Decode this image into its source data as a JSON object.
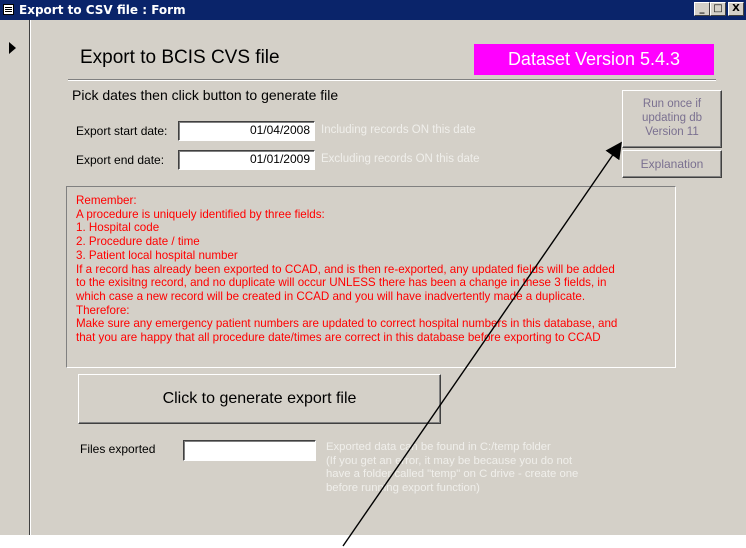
{
  "window": {
    "title": "Export to CSV file : Form",
    "minimize_label": "_",
    "maximize_label": "□",
    "close_label": "X"
  },
  "form": {
    "title": "Export to BCIS CVS file",
    "version_badge": "Dataset Version 5.4.3",
    "instruction": "Pick dates then click button to generate file",
    "start_date": {
      "label": "Export start date:",
      "value": "01/04/2008",
      "hint": "Including records ON this date"
    },
    "end_date": {
      "label": "Export end date:",
      "value": "01/01/2009",
      "hint": "Excluding records ON this date"
    },
    "run_once_button": {
      "line1": "Run once if",
      "line2": "updating db",
      "line3": "Version 11"
    },
    "explanation_button": "Explanation",
    "notes": [
      "Remember:",
      "A procedure is uniquely identified by three fields:",
      "1. Hospital code",
      "2. Procedure date / time",
      "3. Patient local hospital number",
      "If a record has already been exported to CCAD, and is then re-exported, any updated fields will be added",
      "to the exisitng record, and no duplicate will occur UNLESS there has been a change in these 3 fields, in",
      "which case a new record will be created in CCAD and you will have inadvertently made a duplicate.",
      "Therefore:",
      "Make sure any emergency patient numbers are updated to correct hospital numbers in this database, and",
      "that you are happy that all procedure date/times are correct in this database before exporting to CCAD"
    ],
    "generate_button": "Click to generate export file",
    "files_exported": {
      "label": "Files exported",
      "value": "",
      "hint_lines": [
        "Exported data can be found in C:/temp folder",
        "(If you get an error, it may be because you do not",
        "have a folder called \"temp\" on C drive - create one",
        "before running export function)"
      ]
    }
  },
  "colors": {
    "titlebar": "#0a246a",
    "form_background": "#d4d0c8",
    "version_badge": "#ff00ff",
    "notes_text": "#ff0000",
    "hint_text": "#f0efeb"
  }
}
